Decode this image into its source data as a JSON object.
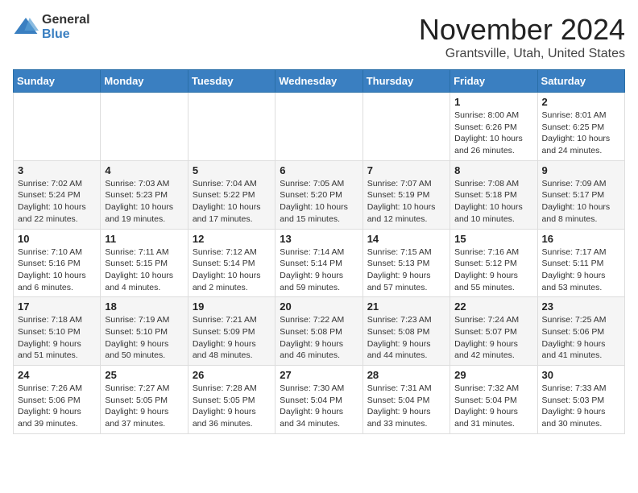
{
  "header": {
    "logo_general": "General",
    "logo_blue": "Blue",
    "month": "November 2024",
    "location": "Grantsville, Utah, United States"
  },
  "days_of_week": [
    "Sunday",
    "Monday",
    "Tuesday",
    "Wednesday",
    "Thursday",
    "Friday",
    "Saturday"
  ],
  "weeks": [
    [
      {
        "day": "",
        "info": ""
      },
      {
        "day": "",
        "info": ""
      },
      {
        "day": "",
        "info": ""
      },
      {
        "day": "",
        "info": ""
      },
      {
        "day": "",
        "info": ""
      },
      {
        "day": "1",
        "info": "Sunrise: 8:00 AM\nSunset: 6:26 PM\nDaylight: 10 hours and 26 minutes."
      },
      {
        "day": "2",
        "info": "Sunrise: 8:01 AM\nSunset: 6:25 PM\nDaylight: 10 hours and 24 minutes."
      }
    ],
    [
      {
        "day": "3",
        "info": "Sunrise: 7:02 AM\nSunset: 5:24 PM\nDaylight: 10 hours and 22 minutes."
      },
      {
        "day": "4",
        "info": "Sunrise: 7:03 AM\nSunset: 5:23 PM\nDaylight: 10 hours and 19 minutes."
      },
      {
        "day": "5",
        "info": "Sunrise: 7:04 AM\nSunset: 5:22 PM\nDaylight: 10 hours and 17 minutes."
      },
      {
        "day": "6",
        "info": "Sunrise: 7:05 AM\nSunset: 5:20 PM\nDaylight: 10 hours and 15 minutes."
      },
      {
        "day": "7",
        "info": "Sunrise: 7:07 AM\nSunset: 5:19 PM\nDaylight: 10 hours and 12 minutes."
      },
      {
        "day": "8",
        "info": "Sunrise: 7:08 AM\nSunset: 5:18 PM\nDaylight: 10 hours and 10 minutes."
      },
      {
        "day": "9",
        "info": "Sunrise: 7:09 AM\nSunset: 5:17 PM\nDaylight: 10 hours and 8 minutes."
      }
    ],
    [
      {
        "day": "10",
        "info": "Sunrise: 7:10 AM\nSunset: 5:16 PM\nDaylight: 10 hours and 6 minutes."
      },
      {
        "day": "11",
        "info": "Sunrise: 7:11 AM\nSunset: 5:15 PM\nDaylight: 10 hours and 4 minutes."
      },
      {
        "day": "12",
        "info": "Sunrise: 7:12 AM\nSunset: 5:14 PM\nDaylight: 10 hours and 2 minutes."
      },
      {
        "day": "13",
        "info": "Sunrise: 7:14 AM\nSunset: 5:14 PM\nDaylight: 9 hours and 59 minutes."
      },
      {
        "day": "14",
        "info": "Sunrise: 7:15 AM\nSunset: 5:13 PM\nDaylight: 9 hours and 57 minutes."
      },
      {
        "day": "15",
        "info": "Sunrise: 7:16 AM\nSunset: 5:12 PM\nDaylight: 9 hours and 55 minutes."
      },
      {
        "day": "16",
        "info": "Sunrise: 7:17 AM\nSunset: 5:11 PM\nDaylight: 9 hours and 53 minutes."
      }
    ],
    [
      {
        "day": "17",
        "info": "Sunrise: 7:18 AM\nSunset: 5:10 PM\nDaylight: 9 hours and 51 minutes."
      },
      {
        "day": "18",
        "info": "Sunrise: 7:19 AM\nSunset: 5:10 PM\nDaylight: 9 hours and 50 minutes."
      },
      {
        "day": "19",
        "info": "Sunrise: 7:21 AM\nSunset: 5:09 PM\nDaylight: 9 hours and 48 minutes."
      },
      {
        "day": "20",
        "info": "Sunrise: 7:22 AM\nSunset: 5:08 PM\nDaylight: 9 hours and 46 minutes."
      },
      {
        "day": "21",
        "info": "Sunrise: 7:23 AM\nSunset: 5:08 PM\nDaylight: 9 hours and 44 minutes."
      },
      {
        "day": "22",
        "info": "Sunrise: 7:24 AM\nSunset: 5:07 PM\nDaylight: 9 hours and 42 minutes."
      },
      {
        "day": "23",
        "info": "Sunrise: 7:25 AM\nSunset: 5:06 PM\nDaylight: 9 hours and 41 minutes."
      }
    ],
    [
      {
        "day": "24",
        "info": "Sunrise: 7:26 AM\nSunset: 5:06 PM\nDaylight: 9 hours and 39 minutes."
      },
      {
        "day": "25",
        "info": "Sunrise: 7:27 AM\nSunset: 5:05 PM\nDaylight: 9 hours and 37 minutes."
      },
      {
        "day": "26",
        "info": "Sunrise: 7:28 AM\nSunset: 5:05 PM\nDaylight: 9 hours and 36 minutes."
      },
      {
        "day": "27",
        "info": "Sunrise: 7:30 AM\nSunset: 5:04 PM\nDaylight: 9 hours and 34 minutes."
      },
      {
        "day": "28",
        "info": "Sunrise: 7:31 AM\nSunset: 5:04 PM\nDaylight: 9 hours and 33 minutes."
      },
      {
        "day": "29",
        "info": "Sunrise: 7:32 AM\nSunset: 5:04 PM\nDaylight: 9 hours and 31 minutes."
      },
      {
        "day": "30",
        "info": "Sunrise: 7:33 AM\nSunset: 5:03 PM\nDaylight: 9 hours and 30 minutes."
      }
    ]
  ]
}
